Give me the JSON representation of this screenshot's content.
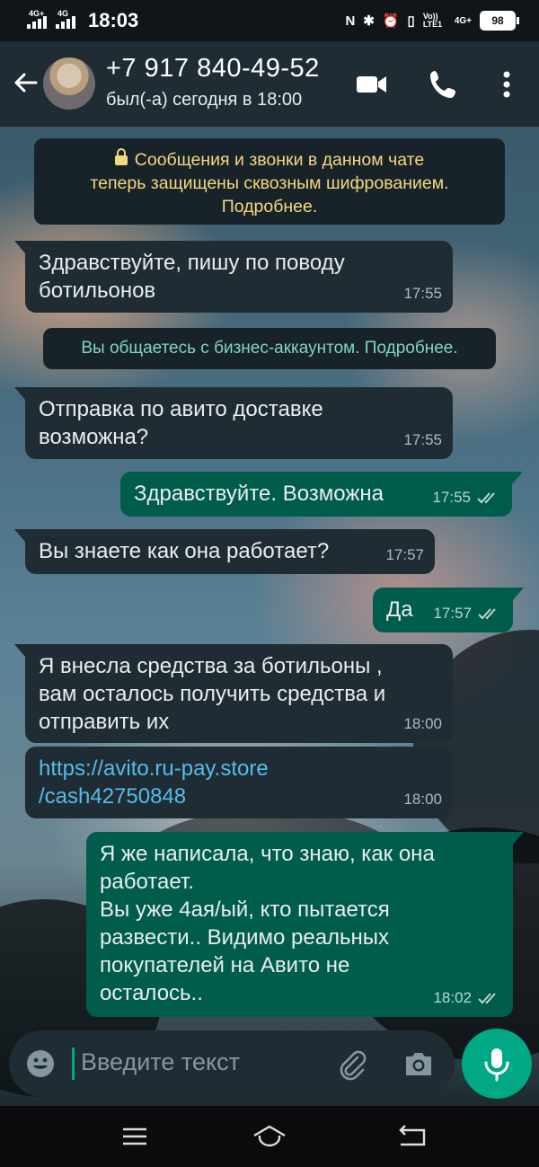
{
  "status_bar": {
    "time": "18:03",
    "signal1": "4G+",
    "signal2": "4G",
    "network_right": "4G+",
    "volte": "Vo)) LTE1",
    "battery": "98"
  },
  "header": {
    "contact_name": "+7 917 840-49-52",
    "last_seen": "был(-а) сегодня в 18:00",
    "icons": [
      "back-arrow-icon",
      "video-call-icon",
      "phone-icon",
      "more-vert-icon"
    ]
  },
  "encryption_notice": {
    "line1": "Сообщения и звонки в данном чате",
    "line2": "теперь защищены сквозным шифрованием.",
    "line3": "Подробнее."
  },
  "business_notice": "Вы общаетесь с бизнес-аккаунтом. Подробнее.",
  "messages": [
    {
      "direction": "in",
      "text": "Здравствуйте, пишу по поводу\nботильонов",
      "time": "17:55"
    },
    {
      "direction": "in",
      "text": "Отправка по авито доставке\nвозможна?",
      "time": "17:55"
    },
    {
      "direction": "out",
      "text": "Здравствуйте. Возможна",
      "time": "17:55",
      "status": "read"
    },
    {
      "direction": "in",
      "text": "Вы знаете как она работает?",
      "time": "17:57"
    },
    {
      "direction": "out",
      "text": "Да",
      "time": "17:57",
      "status": "read"
    },
    {
      "direction": "in",
      "text": "Я внесла средства за ботильоны ,\nвам осталось получить средства и\nотправить их",
      "time": "18:00"
    },
    {
      "direction": "in",
      "text": "https://avito.ru-pay.store\n/cash42750848",
      "time": "18:00",
      "is_link": true
    },
    {
      "direction": "out",
      "text": "Я же написала, что знаю, как она\nработает.\nВы уже 4ая/ый, кто пытается\nразвести.. Видимо реальных\nпокупателей на Авито не\nосталось..",
      "time": "18:02",
      "status": "read"
    }
  ],
  "composer": {
    "placeholder": "Введите текст",
    "icons": [
      "emoji-icon",
      "attach-icon",
      "camera-icon",
      "mic-icon"
    ]
  },
  "colors": {
    "header_bg": "#1f2c33",
    "incoming_bubble": "#202c33",
    "outgoing_bubble": "#005c4b",
    "accent": "#00a884",
    "notice_text": "#f5d780",
    "link": "#53bdeb"
  }
}
